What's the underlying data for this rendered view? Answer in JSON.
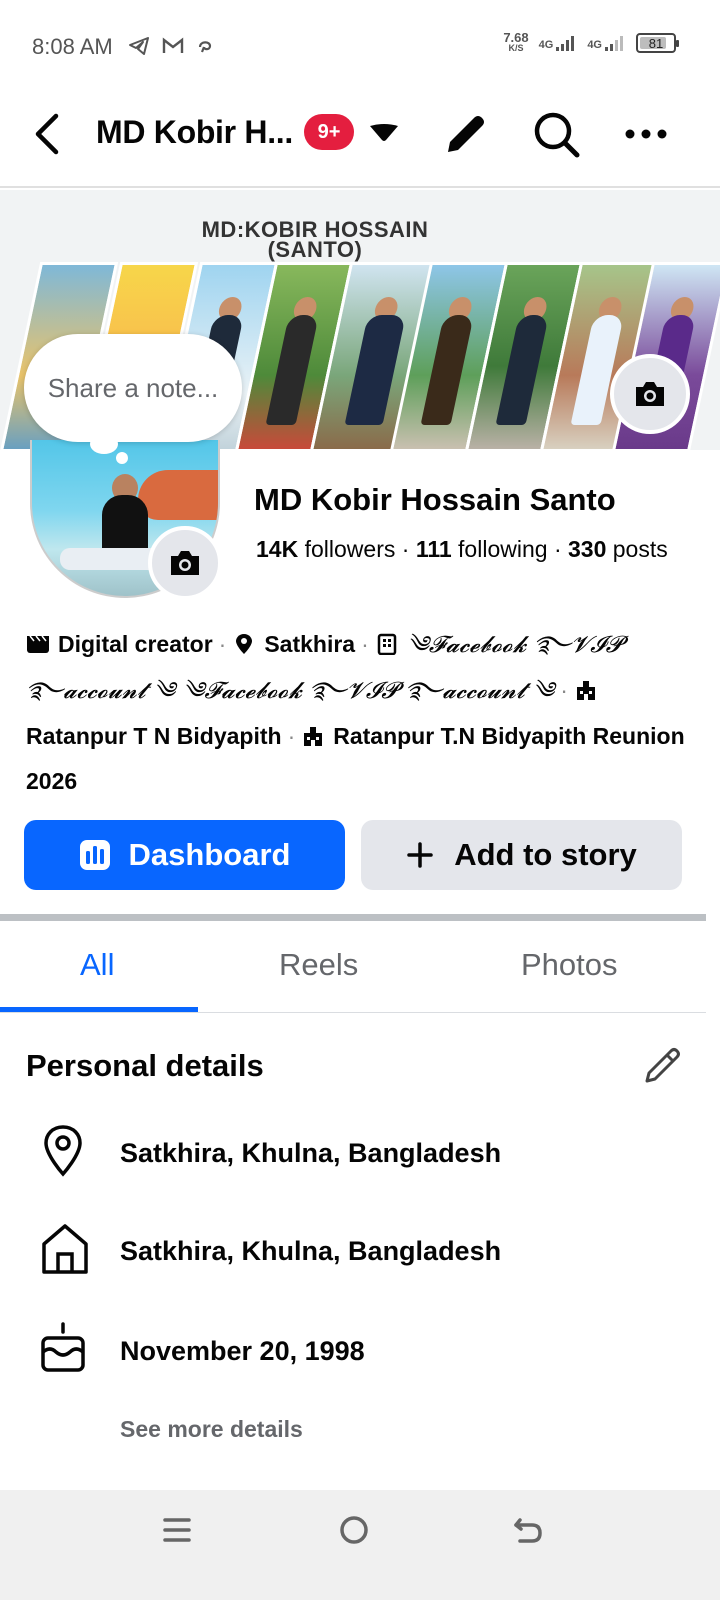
{
  "status_bar": {
    "time": "8:08 AM",
    "speed_value": "7.68",
    "speed_unit": "K/S",
    "network_1": "4G",
    "network_2": "4G",
    "battery": "81",
    "battery_level_percent": 81,
    "icons": [
      "telegram-icon",
      "gmail-icon",
      "notification-icon"
    ]
  },
  "header": {
    "title": "MD Kobir H...",
    "badge": "9+",
    "icons": [
      "back-icon",
      "dropdown-caret-icon",
      "edit-pencil-icon",
      "search-icon",
      "more-icon"
    ]
  },
  "cover": {
    "title_line1": "MD:KOBIR HOSSAIN",
    "title_line2": "(SANTO)"
  },
  "note": {
    "placeholder": "Share a note..."
  },
  "profile": {
    "name": "MD Kobir Hossain Santo",
    "followers_count": "14K",
    "followers_label": "followers",
    "following_count": "111",
    "following_label": "following",
    "posts_count": "330",
    "posts_label": "posts",
    "separator": "·"
  },
  "intro": {
    "category": "Digital creator",
    "location": "Satkhira",
    "page_text_1": "༄𝓕𝓪𝓬𝓮𝓫𝓸𝓸𝓴 ࿐𝓥𝓘𝓟 ࿐𝓪𝓬𝓬𝓸𝓾𝓷𝓽 ༄ ༄𝓕𝓪𝓬𝓮𝓫𝓸𝓸𝓴 ࿐𝓥𝓘𝓟 ࿐𝓪𝓬𝓬𝓸𝓾𝓷𝓽 ༄",
    "school_1": "Ratanpur T N Bidyapith",
    "school_2": "Ratanpur T.N Bidyapith Reunion 2026"
  },
  "actions": {
    "dashboard": "Dashboard",
    "add_story": "Add to story"
  },
  "tabs": [
    {
      "label": "All",
      "active": true
    },
    {
      "label": "Reels",
      "active": false
    },
    {
      "label": "Photos",
      "active": false
    }
  ],
  "personal_details": {
    "title": "Personal details",
    "current_city": "Satkhira, Khulna, Bangladesh",
    "hometown": "Satkhira, Khulna, Bangladesh",
    "birthday": "November 20, 1998",
    "see_more": "See more details"
  },
  "colors": {
    "accent": "#0866ff",
    "badge": "#e41e3f",
    "secondary_button": "#e4e6eb",
    "muted_text": "#65676b"
  }
}
